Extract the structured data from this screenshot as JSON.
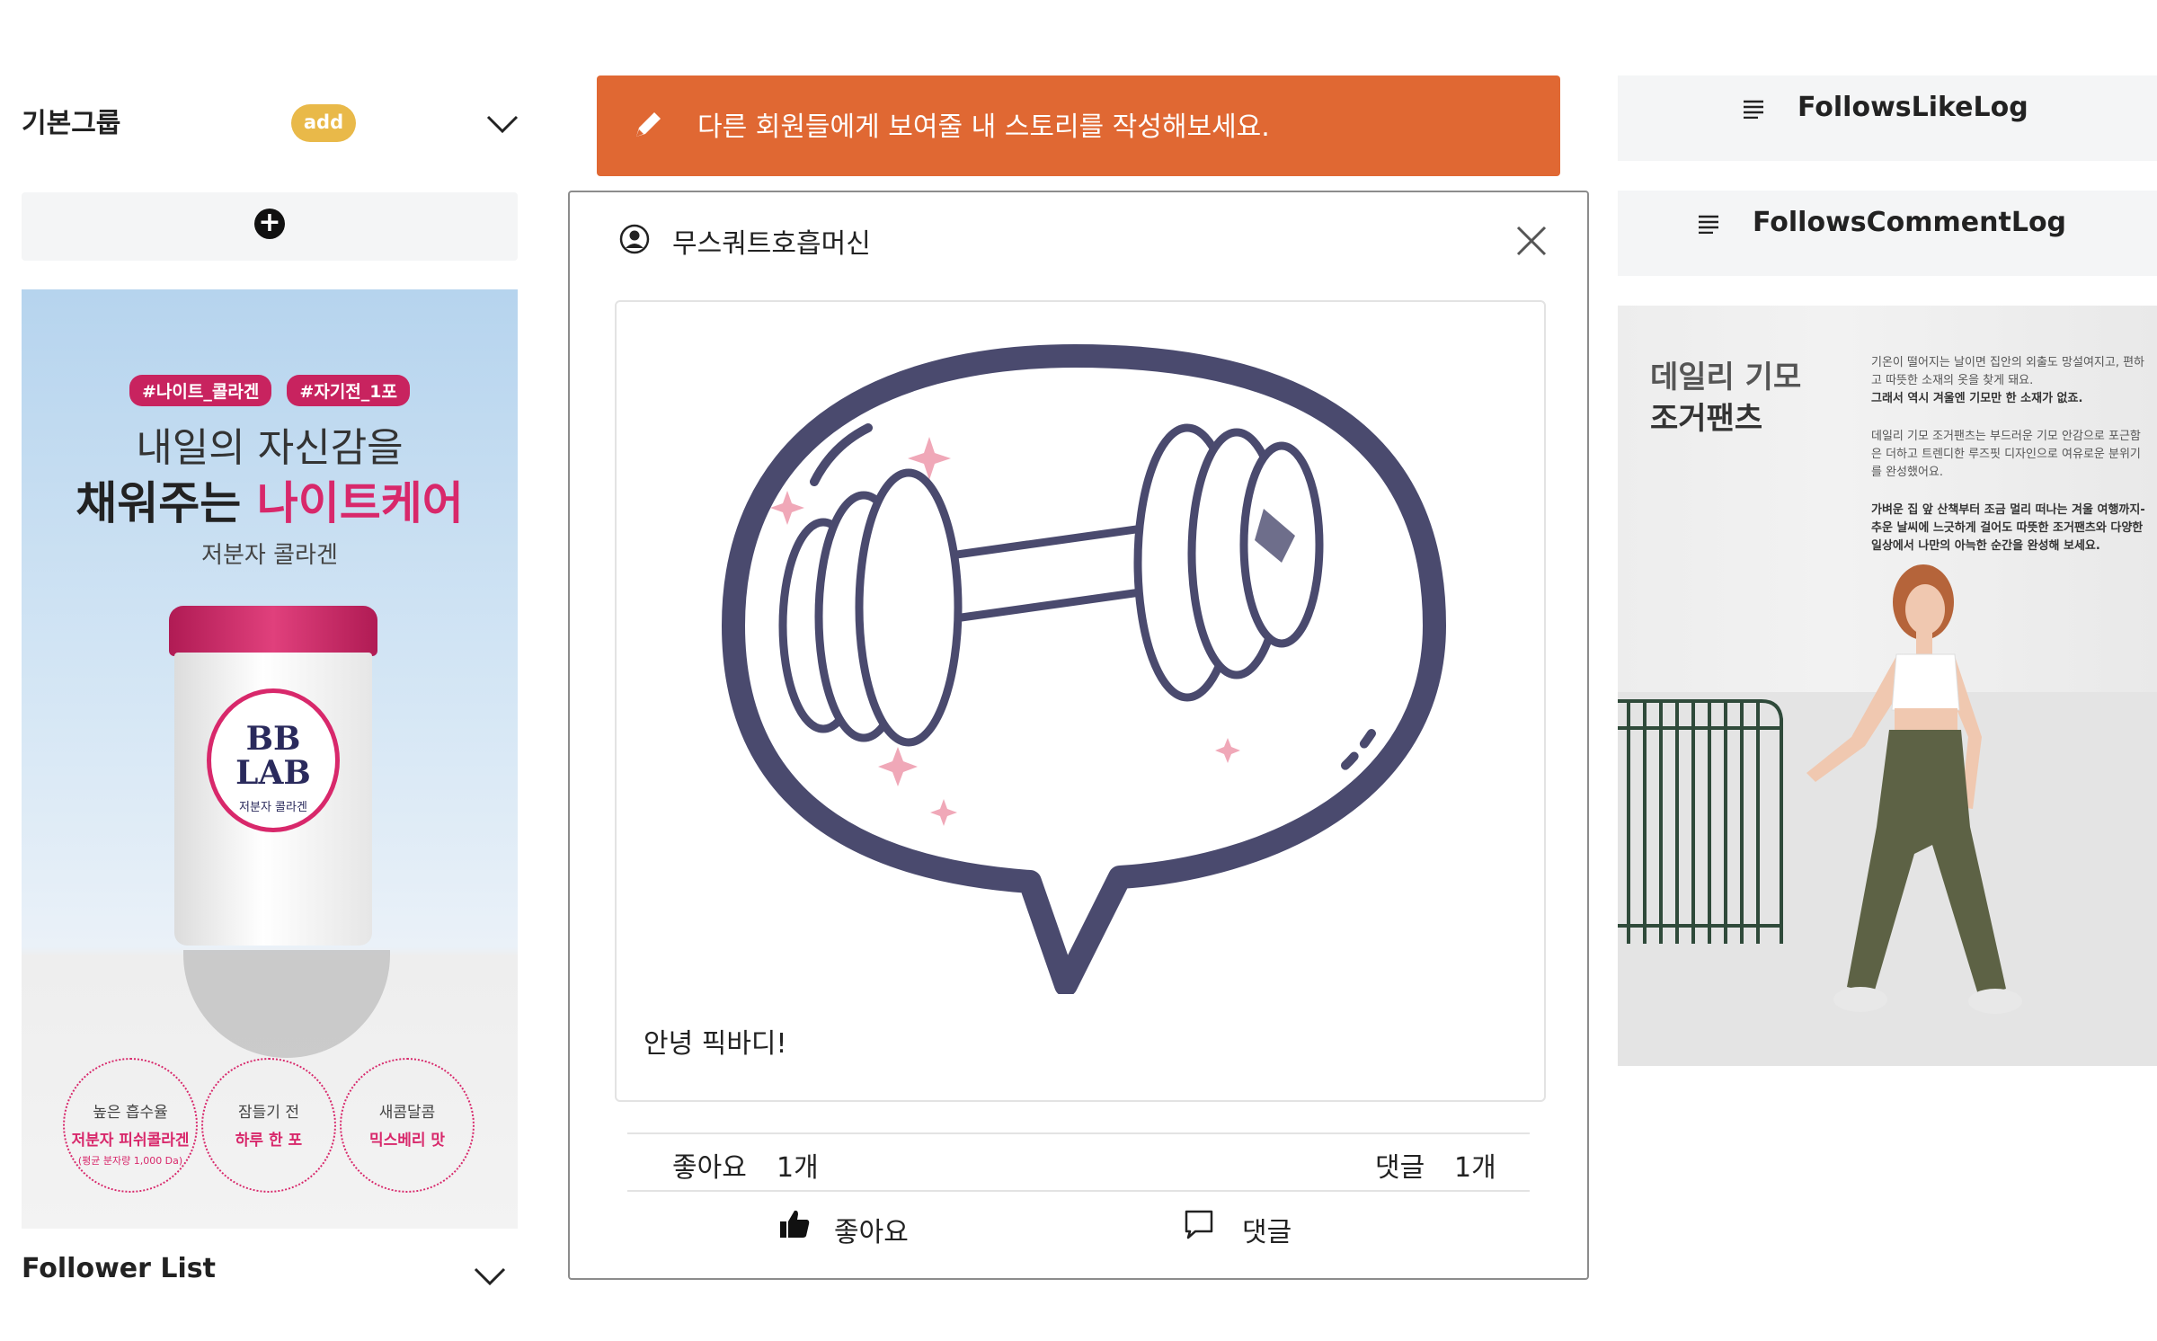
{
  "left": {
    "group_title": "기본그룹",
    "add_badge": "add",
    "ad": {
      "tags": [
        "#나이트_콜라겐",
        "#자기전_1포"
      ],
      "headline_1": "내일의 자신감을",
      "headline_2_prefix": "채워주는 ",
      "headline_2_highlight": "나이트케어",
      "sub": "저분자 콜라겐",
      "product_brand_1": "BB",
      "product_brand_2": "LAB",
      "product_name": "저분자 콜라겐",
      "features": [
        {
          "line1": "높은 흡수율",
          "line2": "저분자 피쉬콜라겐",
          "line3": "(평균 분자량 1,000 Da)"
        },
        {
          "line1": "잠들기 전",
          "line2": "하루 한 포",
          "line3": ""
        },
        {
          "line1": "새콤달콤",
          "line2": "믹스베리 맛",
          "line3": ""
        }
      ]
    },
    "follower_title": "Follower List"
  },
  "center": {
    "story_prompt": "다른 회원들에게 보여줄 내 스토리를 작성해보세요.",
    "post": {
      "username": "무스쿼트호흡머신",
      "text": "안녕 픽바디!",
      "likes_label": "좋아요",
      "likes_count": "1개",
      "comments_label": "댓글",
      "comments_count": "1개",
      "like_button": "좋아요",
      "comment_button": "댓글"
    }
  },
  "right": {
    "likes_log": "FollowsLikeLog",
    "comments_log": "FollowsCommentLog",
    "ad": {
      "title_1": "데일리 기모",
      "title_2": "조거팬츠",
      "para_1": "기온이 떨어지는 날이면 집안의 외출도 망설여지고, 편하고 따뜻한 소재의 옷을 찾게 돼요.",
      "para_1_bold": "그래서 역시 겨울엔 기모만 한 소재가 없죠.",
      "para_2": "데일리 기모 조거팬츠는 부드러운 기모 안감으로 포근함은 더하고 트렌디한 루즈핏 디자인으로 여유로운 분위기를 완성했어요.",
      "para_3_bold": "가벼운 집 앞 산책부터 조금 멀리 떠나는 겨울 여행까지- 추운 날씨에 느긋하게 걸어도 따뜻한 조거팬츠와 다양한 일상에서 나만의 아늑한 순간을 완성해 보세요."
    }
  },
  "colors": {
    "banner": "#e06833",
    "badge": "#e9b949",
    "accent_pink": "#d8286b"
  }
}
